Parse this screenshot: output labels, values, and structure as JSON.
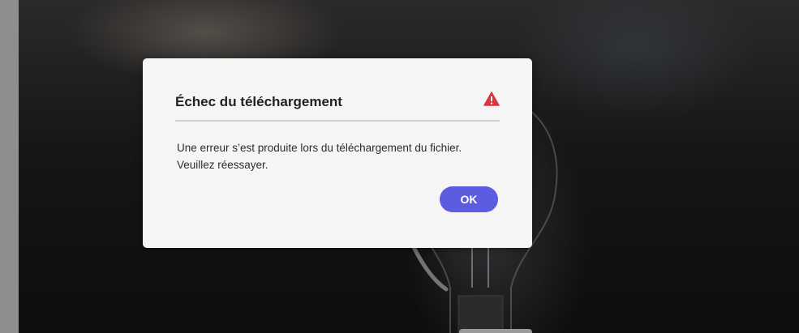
{
  "dialog": {
    "title": "Échec du téléchargement",
    "message": "Une erreur s’est produite lors du téléchargement du fichier. Veuillez réessayer.",
    "ok_label": "OK",
    "icon": "alert-triangle-icon",
    "icon_color": "#d7373f",
    "button_color": "#5c5ce0"
  }
}
